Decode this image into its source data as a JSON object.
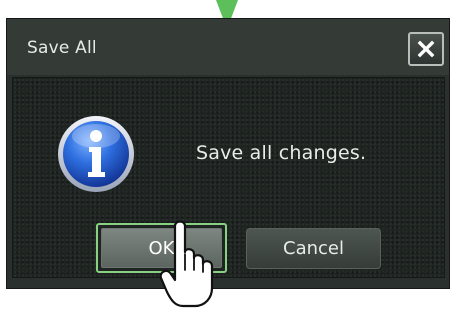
{
  "dialog": {
    "title": "Save All",
    "message": "Save all changes.",
    "ok_label": "OK",
    "cancel_label": "Cancel"
  },
  "icons": {
    "close": "close-x-icon",
    "info": "info-icon",
    "cursor": "hand-pointer-cursor-icon",
    "pointer": "down-arrow-pointer-icon"
  },
  "colors": {
    "dialog_background": "#2a302d",
    "title_bar": "#343b37",
    "focus_ring": "#8ad083",
    "info_icon_blue": "#1f56c8",
    "arrow_green": "#5cbf5a"
  }
}
